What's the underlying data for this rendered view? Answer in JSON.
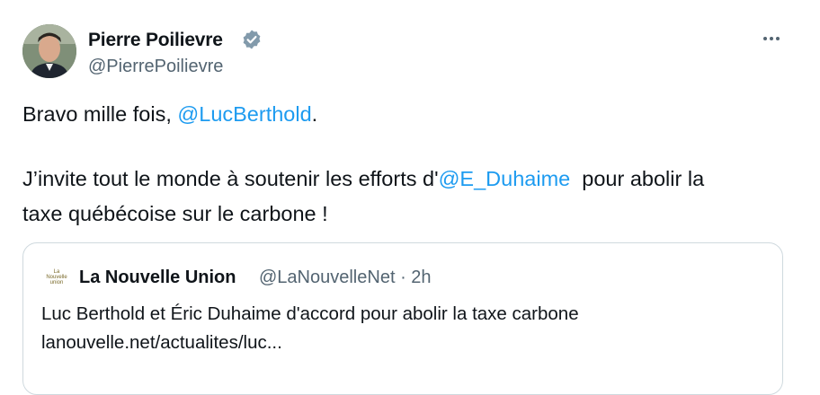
{
  "tweet": {
    "author_name": "Pierre Poilievre",
    "handle": "@PierrePoilievre",
    "verified_icon": "verified-badge-icon",
    "line1_prefix": "Bravo mille fois, ",
    "line1_mention": "@LucBerthold",
    "line1_suffix": ".",
    "line2_prefix": "J’invite tout le monde à soutenir les efforts d'",
    "line2_mention": "@E_Duhaime",
    "line2_suffix": "  pour abolir la",
    "line3": "taxe québécoise sur le carbone !"
  },
  "quote": {
    "logo_text": "La Nouvelle union",
    "author_name": "La Nouvelle Union",
    "handle": "@LaNouvelleNet",
    "separator": "·",
    "time": "2h",
    "headline": "Luc Berthold et Éric Duhaime d'accord pour abolir la taxe carbone",
    "link": "lanouvelle.net/actualites/luc..."
  },
  "colors": {
    "link": "#1d9bf0",
    "secondary_text": "#536471",
    "border": "#cfd9de"
  }
}
